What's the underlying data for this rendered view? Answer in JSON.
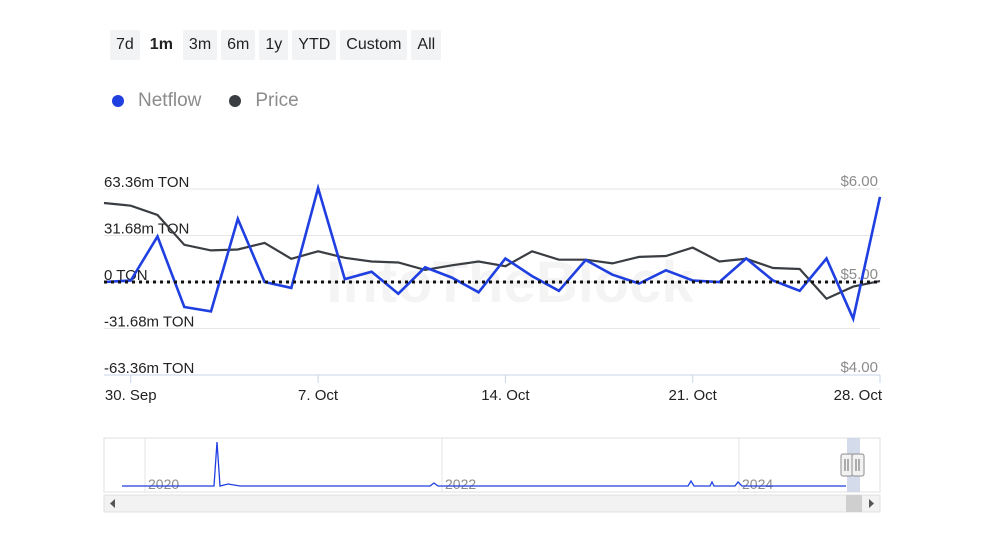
{
  "range_buttons": [
    {
      "label": "7d",
      "active": false
    },
    {
      "label": "1m",
      "active": true
    },
    {
      "label": "3m",
      "active": false
    },
    {
      "label": "6m",
      "active": false
    },
    {
      "label": "1y",
      "active": false
    },
    {
      "label": "YTD",
      "active": false
    },
    {
      "label": "Custom",
      "active": false
    },
    {
      "label": "All",
      "active": false
    }
  ],
  "legend": [
    {
      "label": "Netflow",
      "color": "#1f3fe0"
    },
    {
      "label": "Price",
      "color": "#3a3d42"
    }
  ],
  "watermark": "IntoTheBlock",
  "chart_data": {
    "type": "line",
    "left_axis": {
      "ticks": [
        "63.36m TON",
        "31.68m TON",
        "0 TON",
        "-31.68m TON",
        "-63.36m TON"
      ],
      "ylim": [
        -63.36,
        63.36
      ]
    },
    "right_axis": {
      "ticks": [
        "$6.00",
        "$5.00",
        "$4.00"
      ],
      "ylim": [
        4.0,
        6.0
      ]
    },
    "x_ticks": [
      {
        "label": "30. Sep",
        "index": 1
      },
      {
        "label": "7. Oct",
        "index": 8
      },
      {
        "label": "14. Oct",
        "index": 15
      },
      {
        "label": "21. Oct",
        "index": 22
      },
      {
        "label": "28. Oct",
        "index": 29
      }
    ],
    "x_count": 30,
    "series": [
      {
        "name": "Netflow",
        "color": "#1f3fe0",
        "values": [
          0,
          1,
          31,
          -17,
          -20,
          43,
          0,
          -4,
          64,
          2,
          7,
          -8,
          10,
          3,
          -7,
          16,
          4,
          -6,
          15,
          5,
          -1,
          8,
          1,
          0,
          16,
          1,
          -6,
          16,
          -25,
          58
        ]
      },
      {
        "name": "Price",
        "color": "#3a3d42",
        "values": [
          5.85,
          5.82,
          5.72,
          5.4,
          5.34,
          5.35,
          5.42,
          5.25,
          5.33,
          5.26,
          5.22,
          5.21,
          5.13,
          5.18,
          5.22,
          5.17,
          5.33,
          5.24,
          5.24,
          5.2,
          5.27,
          5.28,
          5.37,
          5.22,
          5.25,
          5.15,
          5.14,
          4.82,
          4.95,
          5.01
        ]
      }
    ]
  },
  "navigator": {
    "year_labels": [
      "2020",
      "2022",
      "2024"
    ]
  }
}
